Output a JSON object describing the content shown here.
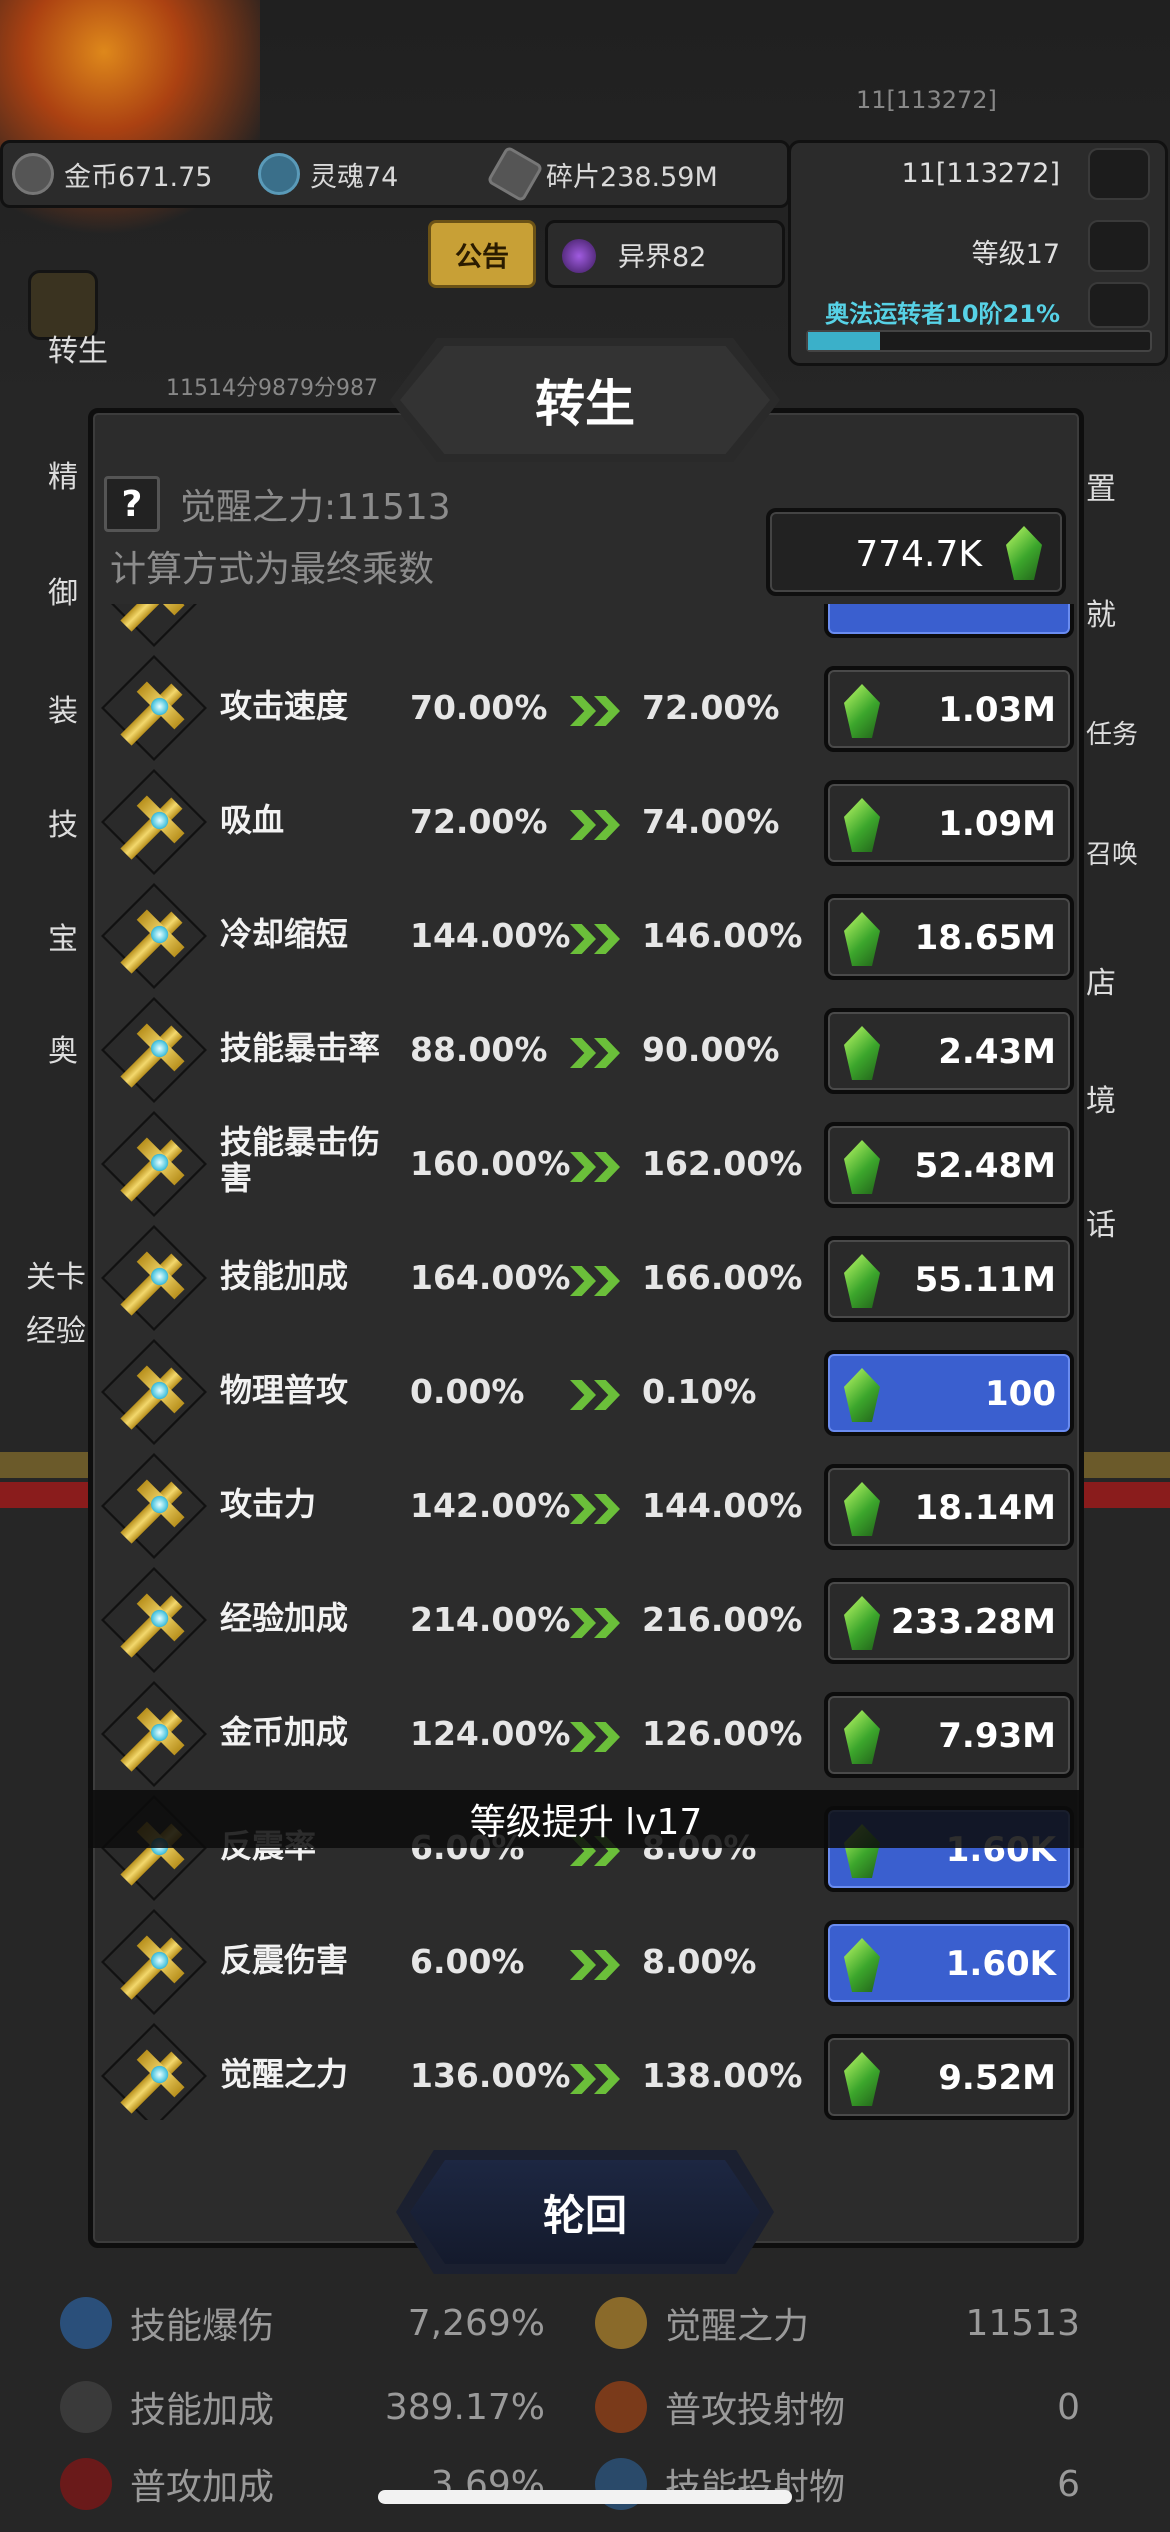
{
  "top_id_faint": "11[113272]",
  "resources": [
    {
      "icon": "gold-coin-icon",
      "label": "金币671.75"
    },
    {
      "icon": "soul-icon",
      "label": "灵魂74"
    },
    {
      "icon": "shard-icon",
      "label": "碎片238.59M"
    }
  ],
  "profile": {
    "id": "11[113272]",
    "level": "等级17",
    "class_progress": "奥法运转者10阶21%",
    "xp_fraction": 0.21
  },
  "notice_label": "公告",
  "realm_label": "异界82",
  "faint_score_text": "11514分9879分987",
  "left_menu": [
    "转生",
    "精",
    "御",
    "装",
    "技",
    "宝",
    "奥"
  ],
  "right_menu": [
    "置",
    "就",
    "任务",
    "召唤",
    "店",
    "境",
    "话"
  ],
  "left_misc": [
    "关卡",
    "经验"
  ],
  "dialog": {
    "title": "转生",
    "help": "?",
    "awaken_label": "觉醒之力:11513",
    "calc_note": "计算方式为最终乘数",
    "currency_value": "774.7K",
    "rows": [
      {
        "name": "攻击速度",
        "current": "70.00%",
        "next": "72.00%",
        "cost": "1.03M",
        "affordable": false
      },
      {
        "name": "吸血",
        "current": "72.00%",
        "next": "74.00%",
        "cost": "1.09M",
        "affordable": false
      },
      {
        "name": "冷却缩短",
        "current": "144.00%",
        "next": "146.00%",
        "cost": "18.65M",
        "affordable": false
      },
      {
        "name": "技能暴击率",
        "current": "88.00%",
        "next": "90.00%",
        "cost": "2.43M",
        "affordable": false
      },
      {
        "name": "技能暴击伤害",
        "current": "160.00%",
        "next": "162.00%",
        "cost": "52.48M",
        "affordable": false
      },
      {
        "name": "技能加成",
        "current": "164.00%",
        "next": "166.00%",
        "cost": "55.11M",
        "affordable": false
      },
      {
        "name": "物理普攻",
        "current": "0.00%",
        "next": "0.10%",
        "cost": "100",
        "affordable": true
      },
      {
        "name": "攻击力",
        "current": "142.00%",
        "next": "144.00%",
        "cost": "18.14M",
        "affordable": false
      },
      {
        "name": "经验加成",
        "current": "214.00%",
        "next": "216.00%",
        "cost": "233.28M",
        "affordable": false
      },
      {
        "name": "金币加成",
        "current": "124.00%",
        "next": "126.00%",
        "cost": "7.93M",
        "affordable": false
      },
      {
        "name": "反震率",
        "current": "6.00%",
        "next": "8.00%",
        "cost": "1.60K",
        "affordable": true
      },
      {
        "name": "反震伤害",
        "current": "6.00%",
        "next": "8.00%",
        "cost": "1.60K",
        "affordable": true
      },
      {
        "name": "觉醒之力",
        "current": "136.00%",
        "next": "138.00%",
        "cost": "9.52M",
        "affordable": false
      }
    ],
    "levelup_banner": "等级提升 lv17",
    "reincarnate_label": "轮回"
  },
  "bottom_stats": [
    [
      {
        "icon": "blue-flame-icon",
        "label": "技能爆伤",
        "value": "7,269%"
      },
      {
        "icon": "awaken-emblem-icon",
        "label": "觉醒之力",
        "value": "11513"
      }
    ],
    [
      {
        "icon": "lightning-icon",
        "label": "技能加成",
        "value": "389.17%"
      },
      {
        "icon": "fire-orb-icon",
        "label": "普攻投射物",
        "value": "0"
      }
    ],
    [
      {
        "icon": "sword-icon",
        "label": "普攻加成",
        "value": "3.69%"
      },
      {
        "icon": "feather-icon",
        "label": "技能投射物",
        "value": "6"
      }
    ]
  ],
  "colors": {
    "affordable_button": "#3a5fcf",
    "gem_green": "#3ca62c",
    "notice_gold": "#c8a036",
    "xp_cyan": "#3bb0c9",
    "class_text_cyan": "#57d2e6"
  }
}
